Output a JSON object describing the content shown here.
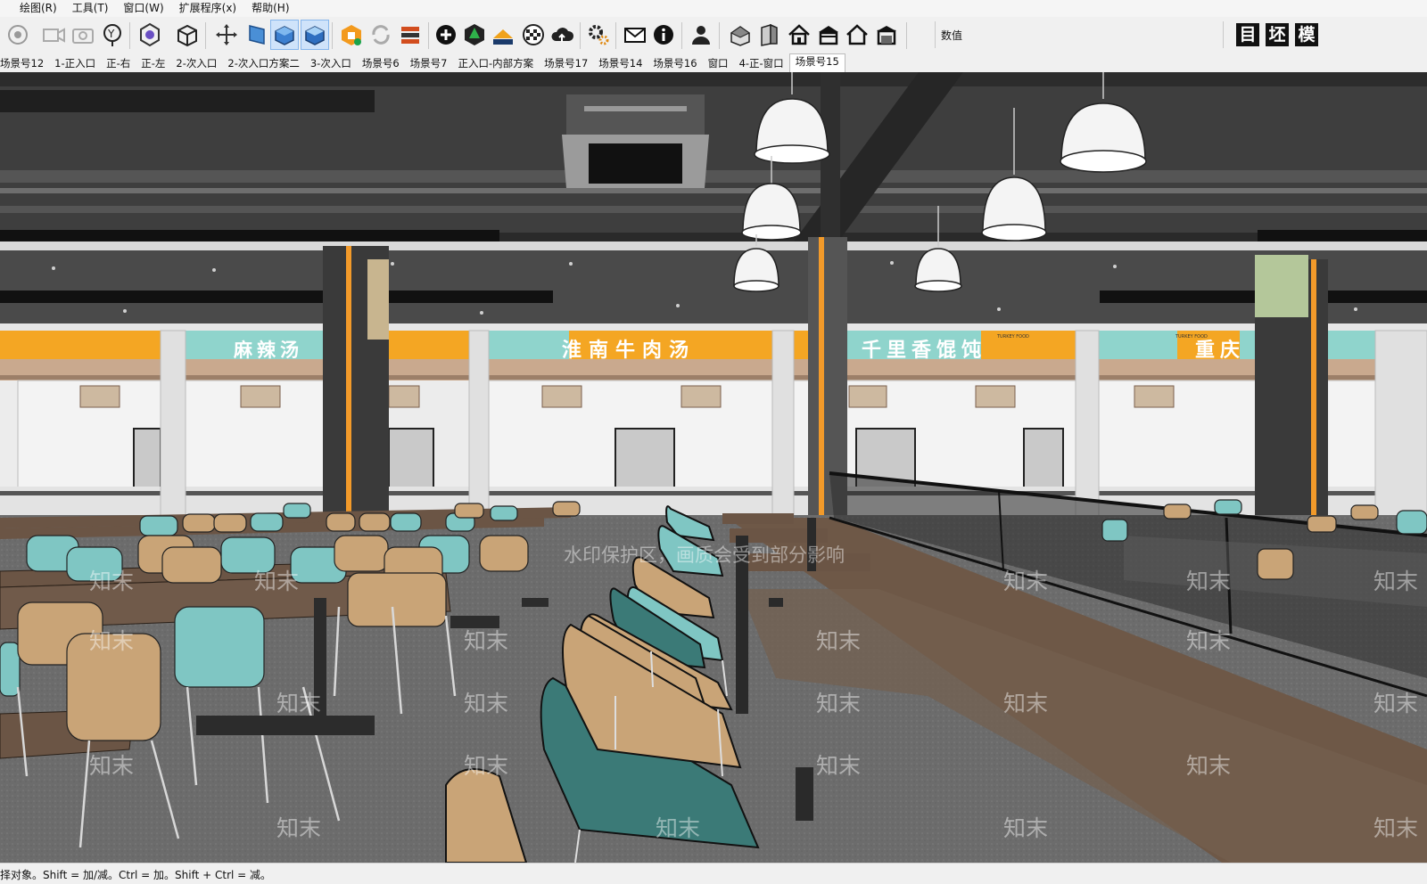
{
  "menu": [
    "绘图(R)",
    "工具(T)",
    "窗口(W)",
    "扩展程序(x)",
    "帮助(H)"
  ],
  "toolbar": {
    "groups": [
      [
        "record-icon",
        "camera-icon",
        "photo-camera-icon",
        "position-camera-icon"
      ],
      [
        "component-icon",
        "box-icon"
      ],
      [
        "move-icon",
        "section-icon",
        "section-fill-icon",
        "section-display-icon"
      ],
      [
        "sketchup-icon",
        "refresh-icon",
        "import-export-icon"
      ],
      [
        "add-icon",
        "tree-icon",
        "layer-icon",
        "checker-icon",
        "cloud-icon"
      ],
      [
        "settings-icon"
      ],
      [
        "mail-icon",
        "info-icon"
      ],
      [
        "user-icon"
      ],
      [
        "house-icon",
        "wall-icon",
        "home-icon",
        "roof-icon",
        "home-outline-icon",
        "garage-icon"
      ]
    ],
    "value_label": "数值",
    "plugin_buttons": [
      "目",
      "坯",
      "模"
    ]
  },
  "scenes": [
    "场景号12",
    "1-正入口",
    "正-右",
    "正-左",
    "2-次入口",
    "2-次入口方案二",
    "3-次入口",
    "场景号6",
    "场景号7",
    "正入口-内部方案",
    "场景号17",
    "场景号14",
    "场景号16",
    "窗口",
    "4-正-窗口",
    "场景号15"
  ],
  "active_scene": "场景号15",
  "viewport": {
    "signs": [
      "麻辣汤",
      "淮南牛肉汤",
      "千里香馄饨",
      "重庆"
    ],
    "sign_small": [
      "TURKEY FOOD",
      "TURKEY FOOD"
    ],
    "watermark_notice": "水印保护区，画质会受到部分影响",
    "watermark": "知末"
  },
  "status": "择对象。Shift = 加/减。Ctrl = 加。Shift + Ctrl = 减。",
  "colors": {
    "sign_band": "#f4a623",
    "sign_teal": "#8fd4cc",
    "chair_teal": "#7fc6c3",
    "chair_wood": "#c9a477",
    "table_top": "#6b5545",
    "floor": "#6f6f6f",
    "ceiling": "#404040"
  }
}
